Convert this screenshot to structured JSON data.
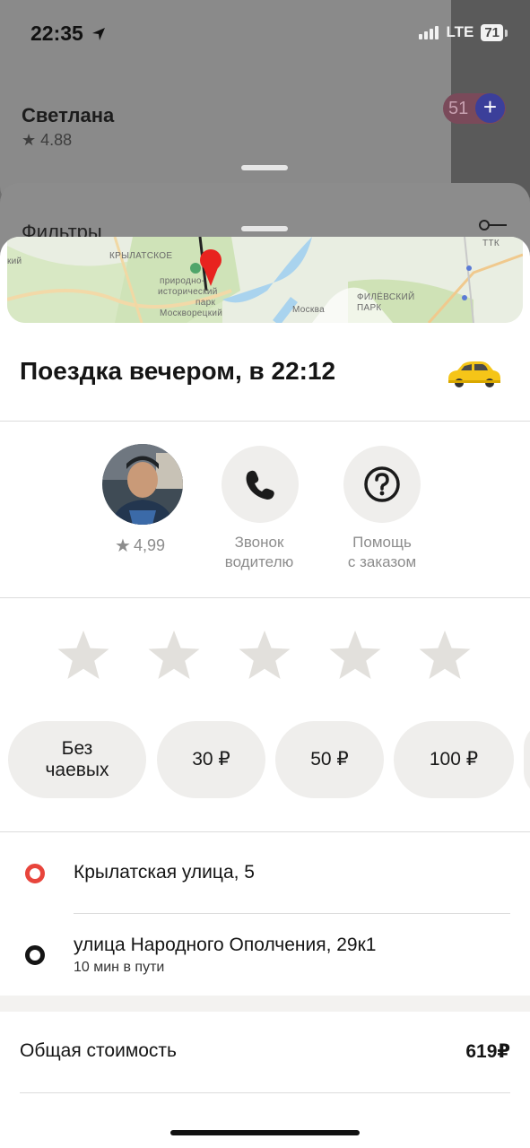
{
  "status_bar": {
    "time": "22:35",
    "network": "LTE",
    "battery": "71"
  },
  "background": {
    "user_name": "Светлана",
    "user_rating": "4.88",
    "badge_text": "51",
    "filters_label": "Фильтры"
  },
  "map": {
    "labels": {
      "district_1": "КРЫЛАТСКОЕ",
      "park_line_1": "природно-",
      "park_line_2": "исторический",
      "park_line_3": "парк",
      "park_line_4": "Москворецкий",
      "park_2_line_1": "ФИЛЁВСКИЙ",
      "park_2_line_2": "ПАРК",
      "river": "Москва",
      "edge_left": "кий",
      "ring": "ТТК"
    }
  },
  "trip": {
    "title": "Поездка вечером, в 22:12",
    "car_icon": "taxi-car-icon"
  },
  "driver": {
    "rating": "4,99",
    "call_label_line1": "Звонок",
    "call_label_line2": "водителю",
    "help_label_line1": "Помощь",
    "help_label_line2": "с заказом"
  },
  "rating_stars": {
    "count": 5,
    "selected": 0
  },
  "tips": {
    "no_tip_line1": "Без",
    "no_tip_line2": "чаевых",
    "tip_1": "30 ₽",
    "tip_2": "50 ₽",
    "tip_3": "100 ₽"
  },
  "route": {
    "from": "Крылатская улица, 5",
    "to": "улица Народного Ополчения, 29к1",
    "duration": "10 мин в пути"
  },
  "cost": {
    "label": "Общая стоимость",
    "value": "619₽"
  },
  "colors": {
    "accent_red": "#e8453c",
    "chip_bg": "#efeeec",
    "taxi_yellow": "#f5c518"
  }
}
